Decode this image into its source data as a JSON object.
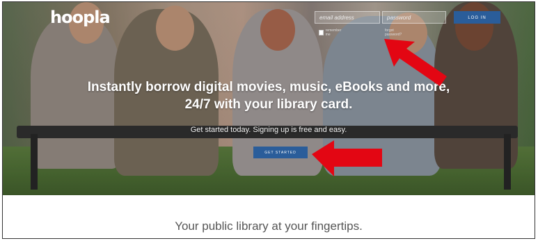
{
  "brand": {
    "logo_text": "hoopla"
  },
  "login": {
    "email_placeholder": "email address",
    "password_placeholder": "password",
    "login_label": "LOG IN",
    "remember_label": "remember me",
    "forgot_label": "forgot password?"
  },
  "hero": {
    "headline_line1": "Instantly borrow digital movies, music, eBooks and more,",
    "headline_line2": "24/7 with your library card.",
    "subhead": "Get started today. Signing up is free and easy.",
    "cta_label": "GET STARTED"
  },
  "footer": {
    "tagline": "Your public library at your fingertips."
  },
  "colors": {
    "accent": "#2a5d9a",
    "arrow": "#e30613"
  }
}
